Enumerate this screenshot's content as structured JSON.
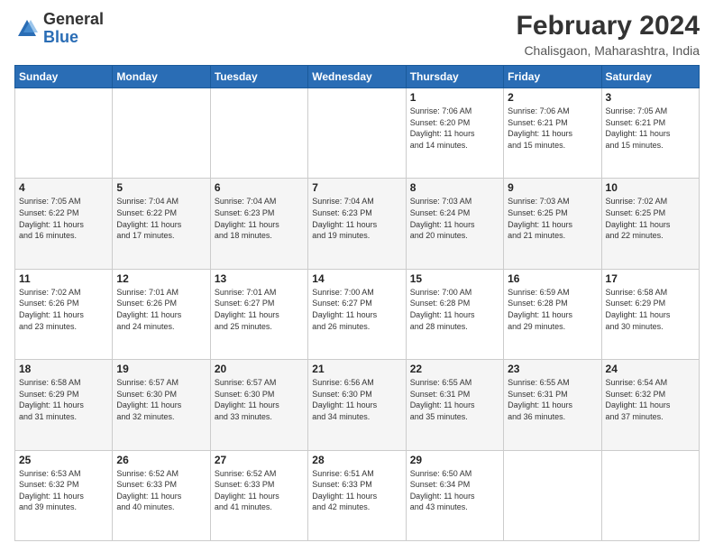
{
  "header": {
    "logo_general": "General",
    "logo_blue": "Blue",
    "month_year": "February 2024",
    "location": "Chalisgaon, Maharashtra, India"
  },
  "weekdays": [
    "Sunday",
    "Monday",
    "Tuesday",
    "Wednesday",
    "Thursday",
    "Friday",
    "Saturday"
  ],
  "weeks": [
    [
      {
        "day": "",
        "info": ""
      },
      {
        "day": "",
        "info": ""
      },
      {
        "day": "",
        "info": ""
      },
      {
        "day": "",
        "info": ""
      },
      {
        "day": "1",
        "info": "Sunrise: 7:06 AM\nSunset: 6:20 PM\nDaylight: 11 hours\nand 14 minutes."
      },
      {
        "day": "2",
        "info": "Sunrise: 7:06 AM\nSunset: 6:21 PM\nDaylight: 11 hours\nand 15 minutes."
      },
      {
        "day": "3",
        "info": "Sunrise: 7:05 AM\nSunset: 6:21 PM\nDaylight: 11 hours\nand 15 minutes."
      }
    ],
    [
      {
        "day": "4",
        "info": "Sunrise: 7:05 AM\nSunset: 6:22 PM\nDaylight: 11 hours\nand 16 minutes."
      },
      {
        "day": "5",
        "info": "Sunrise: 7:04 AM\nSunset: 6:22 PM\nDaylight: 11 hours\nand 17 minutes."
      },
      {
        "day": "6",
        "info": "Sunrise: 7:04 AM\nSunset: 6:23 PM\nDaylight: 11 hours\nand 18 minutes."
      },
      {
        "day": "7",
        "info": "Sunrise: 7:04 AM\nSunset: 6:23 PM\nDaylight: 11 hours\nand 19 minutes."
      },
      {
        "day": "8",
        "info": "Sunrise: 7:03 AM\nSunset: 6:24 PM\nDaylight: 11 hours\nand 20 minutes."
      },
      {
        "day": "9",
        "info": "Sunrise: 7:03 AM\nSunset: 6:25 PM\nDaylight: 11 hours\nand 21 minutes."
      },
      {
        "day": "10",
        "info": "Sunrise: 7:02 AM\nSunset: 6:25 PM\nDaylight: 11 hours\nand 22 minutes."
      }
    ],
    [
      {
        "day": "11",
        "info": "Sunrise: 7:02 AM\nSunset: 6:26 PM\nDaylight: 11 hours\nand 23 minutes."
      },
      {
        "day": "12",
        "info": "Sunrise: 7:01 AM\nSunset: 6:26 PM\nDaylight: 11 hours\nand 24 minutes."
      },
      {
        "day": "13",
        "info": "Sunrise: 7:01 AM\nSunset: 6:27 PM\nDaylight: 11 hours\nand 25 minutes."
      },
      {
        "day": "14",
        "info": "Sunrise: 7:00 AM\nSunset: 6:27 PM\nDaylight: 11 hours\nand 26 minutes."
      },
      {
        "day": "15",
        "info": "Sunrise: 7:00 AM\nSunset: 6:28 PM\nDaylight: 11 hours\nand 28 minutes."
      },
      {
        "day": "16",
        "info": "Sunrise: 6:59 AM\nSunset: 6:28 PM\nDaylight: 11 hours\nand 29 minutes."
      },
      {
        "day": "17",
        "info": "Sunrise: 6:58 AM\nSunset: 6:29 PM\nDaylight: 11 hours\nand 30 minutes."
      }
    ],
    [
      {
        "day": "18",
        "info": "Sunrise: 6:58 AM\nSunset: 6:29 PM\nDaylight: 11 hours\nand 31 minutes."
      },
      {
        "day": "19",
        "info": "Sunrise: 6:57 AM\nSunset: 6:30 PM\nDaylight: 11 hours\nand 32 minutes."
      },
      {
        "day": "20",
        "info": "Sunrise: 6:57 AM\nSunset: 6:30 PM\nDaylight: 11 hours\nand 33 minutes."
      },
      {
        "day": "21",
        "info": "Sunrise: 6:56 AM\nSunset: 6:30 PM\nDaylight: 11 hours\nand 34 minutes."
      },
      {
        "day": "22",
        "info": "Sunrise: 6:55 AM\nSunset: 6:31 PM\nDaylight: 11 hours\nand 35 minutes."
      },
      {
        "day": "23",
        "info": "Sunrise: 6:55 AM\nSunset: 6:31 PM\nDaylight: 11 hours\nand 36 minutes."
      },
      {
        "day": "24",
        "info": "Sunrise: 6:54 AM\nSunset: 6:32 PM\nDaylight: 11 hours\nand 37 minutes."
      }
    ],
    [
      {
        "day": "25",
        "info": "Sunrise: 6:53 AM\nSunset: 6:32 PM\nDaylight: 11 hours\nand 39 minutes."
      },
      {
        "day": "26",
        "info": "Sunrise: 6:52 AM\nSunset: 6:33 PM\nDaylight: 11 hours\nand 40 minutes."
      },
      {
        "day": "27",
        "info": "Sunrise: 6:52 AM\nSunset: 6:33 PM\nDaylight: 11 hours\nand 41 minutes."
      },
      {
        "day": "28",
        "info": "Sunrise: 6:51 AM\nSunset: 6:33 PM\nDaylight: 11 hours\nand 42 minutes."
      },
      {
        "day": "29",
        "info": "Sunrise: 6:50 AM\nSunset: 6:34 PM\nDaylight: 11 hours\nand 43 minutes."
      },
      {
        "day": "",
        "info": ""
      },
      {
        "day": "",
        "info": ""
      }
    ]
  ]
}
